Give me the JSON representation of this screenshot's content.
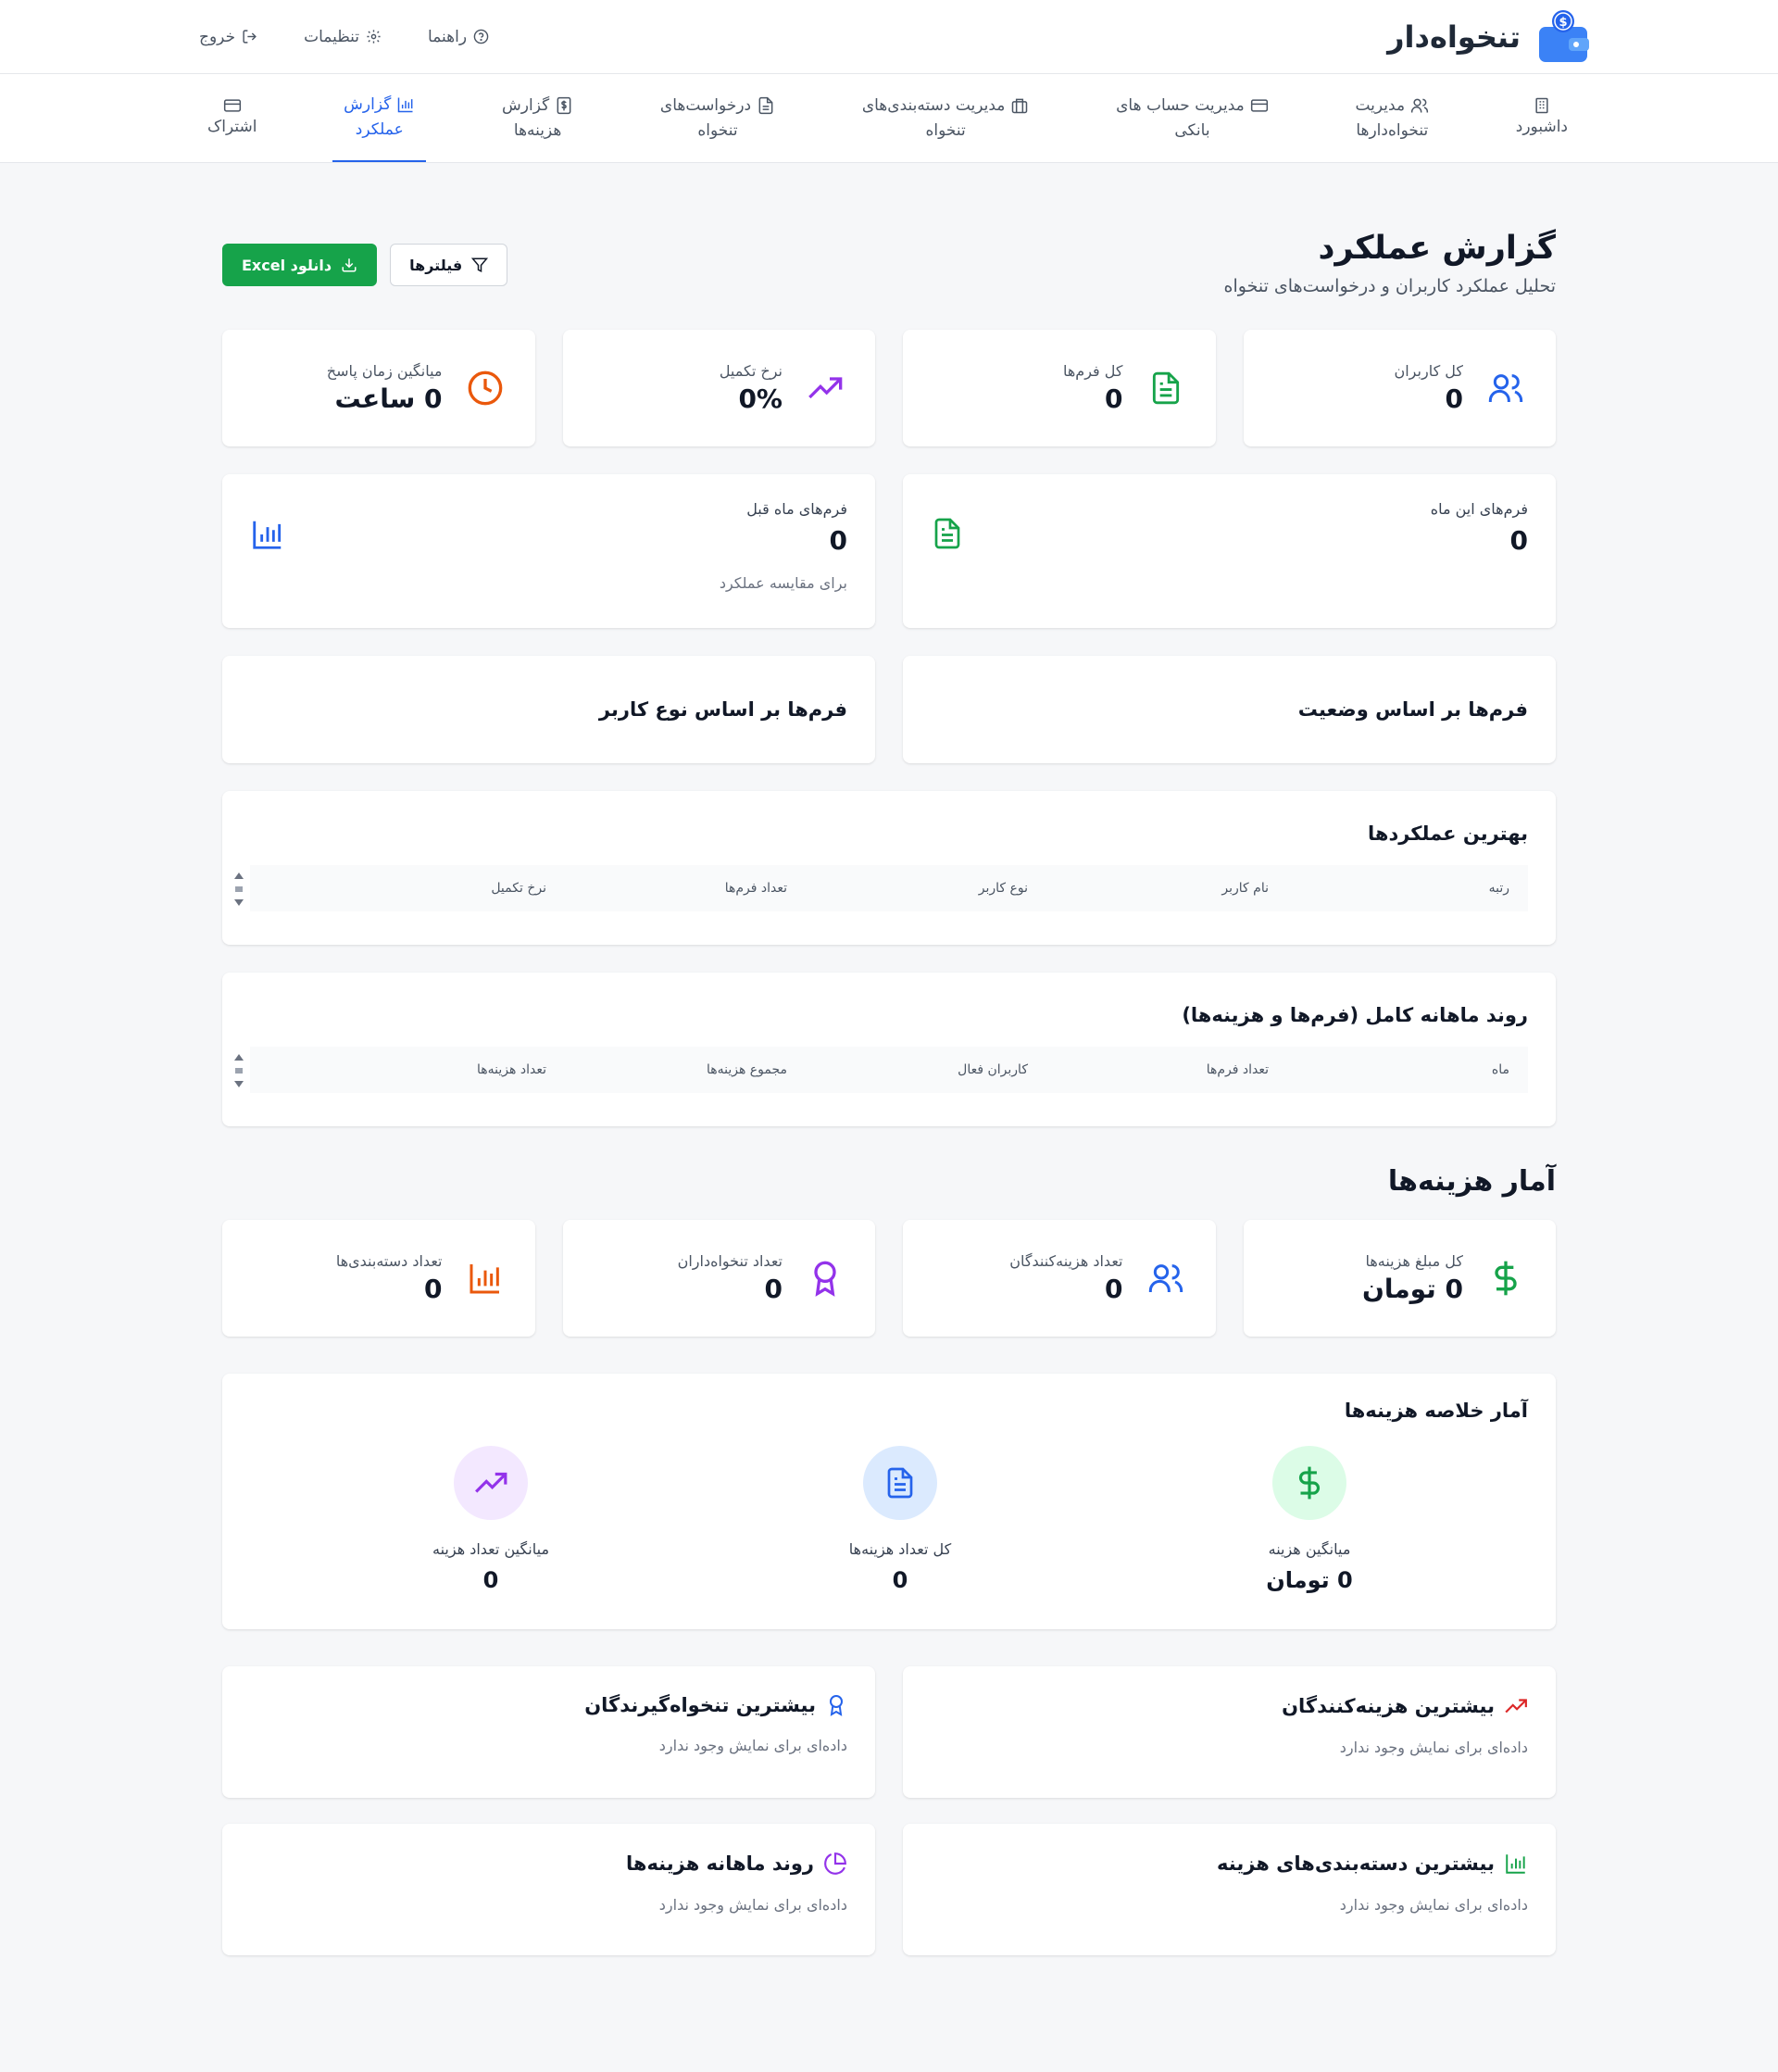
{
  "header": {
    "brand": "تنخواه‌دار",
    "actions": {
      "help": "راهنما",
      "settings": "تنظیمات",
      "logout": "خروج"
    }
  },
  "nav": {
    "tabs": [
      {
        "line1": "داشبورد",
        "line2": "",
        "icon": "building-icon"
      },
      {
        "line1": "مدیریت",
        "line2": "تنخواه‌دارها",
        "icon": "users-icon"
      },
      {
        "line1": "مدیریت حساب های",
        "line2": "بانکی",
        "icon": "credit-card-icon"
      },
      {
        "line1": "مدیریت دسته‌بندی‌های",
        "line2": "تنخواه",
        "icon": "briefcase-icon"
      },
      {
        "line1": "درخواست‌های",
        "line2": "تنخواه",
        "icon": "file-icon"
      },
      {
        "line1": "گزارش",
        "line2": "هزینه‌ها",
        "icon": "receipt-dollar-icon"
      },
      {
        "line1": "گزارش",
        "line2": "عملکرد",
        "icon": "bar-chart-icon",
        "active": true
      },
      {
        "line1": "",
        "line2": "اشتراک",
        "icon": "card-icon"
      }
    ]
  },
  "page": {
    "title": "گزارش عملکرد",
    "subtitle": "تحلیل عملکرد کاربران و درخواست‌های تنخواه",
    "filters_label": "فیلترها",
    "download_label": "دانلود Excel"
  },
  "stats": [
    {
      "label": "کل کاربران",
      "value": "0",
      "icon": "users-icon",
      "color": "#2563eb"
    },
    {
      "label": "کل فرم‌ها",
      "value": "0",
      "icon": "file-text-icon",
      "color": "#16a34a"
    },
    {
      "label": "نرخ تکمیل",
      "value": "0%",
      "icon": "trending-up-icon",
      "color": "#9333ea"
    },
    {
      "label": "میانگین زمان پاسخ",
      "value": "0 ساعت",
      "icon": "clock-icon",
      "color": "#ea580c"
    }
  ],
  "monthly": {
    "this_month": {
      "label": "فرم‌های این ماه",
      "value": "0"
    },
    "last_month": {
      "label": "فرم‌های ماه قبل",
      "value": "0",
      "note": "برای مقایسه عملکرد"
    }
  },
  "sections": {
    "by_status": "فرم‌ها بر اساس وضعیت",
    "by_user_type": "فرم‌ها بر اساس نوع کاربر"
  },
  "top_performers": {
    "title": "بهترین عملکردها",
    "columns": [
      "رتبه",
      "نام کاربر",
      "نوع کاربر",
      "تعداد فرم‌ها",
      "نرخ تکمیل"
    ]
  },
  "monthly_trend": {
    "title": "روند ماهانه کامل (فرم‌ها و هزینه‌ها)",
    "columns": [
      "ماه",
      "تعداد فرم‌ها",
      "کاربران فعال",
      "مجموع هزینه‌ها",
      "تعداد هزینه‌ها"
    ]
  },
  "expense_stats": {
    "heading": "آمار هزینه‌ها",
    "cards": [
      {
        "label": "کل مبلغ هزینه‌ها",
        "value": "0 تومان",
        "icon": "dollar-icon",
        "color": "#16a34a"
      },
      {
        "label": "تعداد هزینه‌کنندگان",
        "value": "0",
        "icon": "users-icon",
        "color": "#2563eb"
      },
      {
        "label": "تعداد تنخواه‌داران",
        "value": "0",
        "icon": "award-icon",
        "color": "#9333ea"
      },
      {
        "label": "تعداد دسته‌بندی‌ها",
        "value": "0",
        "icon": "bar-chart-icon",
        "color": "#ea580c"
      }
    ]
  },
  "summary": {
    "title": "آمار خلاصه هزینه‌ها",
    "items": [
      {
        "label": "میانگین هزینه",
        "value": "0 تومان",
        "icon": "dollar-icon",
        "color": "#16a34a",
        "bg": "#dcfce7"
      },
      {
        "label": "کل تعداد هزینه‌ها",
        "value": "0",
        "icon": "file-text-icon",
        "color": "#2563eb",
        "bg": "#dbeafe"
      },
      {
        "label": "میانگین تعداد هزینه",
        "value": "0",
        "icon": "trending-up-icon",
        "color": "#9333ea",
        "bg": "#f3e8ff"
      }
    ]
  },
  "lists": {
    "top_spenders": {
      "title": "بیشترین هزینه‌کنندگان",
      "empty": "داده‌ای برای نمایش وجود ندارد",
      "color": "#dc2626"
    },
    "top_receivers": {
      "title": "بیشترین تنخواه‌گیرندگان",
      "empty": "داده‌ای برای نمایش وجود ندارد",
      "color": "#2563eb"
    },
    "top_categories": {
      "title": "بیشترین دسته‌بندی‌های هزینه",
      "empty": "داده‌ای برای نمایش وجود ندارد",
      "color": "#16a34a"
    },
    "monthly_expenses": {
      "title": "روند ماهانه هزینه‌ها",
      "empty": "داده‌ای برای نمایش وجود ندارد",
      "color": "#9333ea"
    }
  }
}
